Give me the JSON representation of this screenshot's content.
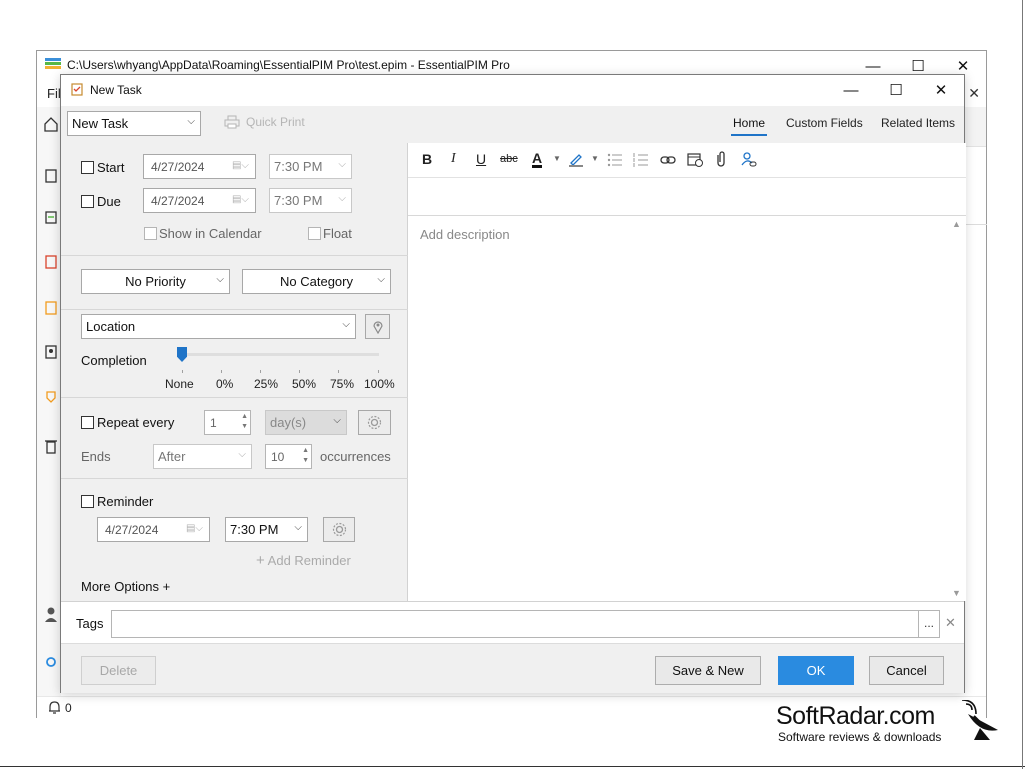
{
  "main_window": {
    "title": "C:\\Users\\whyang\\AppData\\Roaming\\EssentialPIM Pro\\test.epim - EssentialPIM Pro",
    "menu_partial": "Fil",
    "status_count": "0"
  },
  "dialog": {
    "title": "New Task",
    "type_select": "New Task",
    "quick_print": "Quick Print",
    "tabs": [
      "Home",
      "Custom Fields",
      "Related Items"
    ],
    "active_tab": "Home"
  },
  "dates": {
    "start_label": "Start",
    "start_date": "4/27/2024",
    "start_time": "7:30 PM",
    "due_label": "Due",
    "due_date": "4/27/2024",
    "due_time": "7:30 PM",
    "show_in_calendar": "Show in Calendar",
    "float": "Float"
  },
  "classify": {
    "priority": "No Priority",
    "category": "No Category"
  },
  "location": {
    "placeholder": "Location"
  },
  "completion": {
    "label": "Completion",
    "value": "None",
    "ticks": [
      "None",
      "0%",
      "25%",
      "50%",
      "75%",
      "100%"
    ]
  },
  "repeat": {
    "label": "Repeat every",
    "count": "1",
    "unit": "day(s)",
    "ends_label": "Ends",
    "ends_mode": "After",
    "occurrences": "10",
    "occurrences_label": "occurrences"
  },
  "reminder": {
    "label": "Reminder",
    "date": "4/27/2024",
    "time": "7:30 PM",
    "add_label": "Add Reminder"
  },
  "more_options": "More Options +",
  "editor": {
    "buttons": [
      "B",
      "I",
      "U",
      "abc",
      "A"
    ],
    "description_placeholder": "Add description"
  },
  "tags": {
    "label": "Tags",
    "more": "..."
  },
  "footer": {
    "delete": "Delete",
    "save_new": "Save & New",
    "ok": "OK",
    "cancel": "Cancel"
  },
  "colors": {
    "accent": "#2a8be0",
    "tab_underline": "#1f74c8",
    "slider": "#1f74c8"
  },
  "watermark": {
    "name": "SoftRadar.com",
    "tagline": "Software reviews & downloads"
  }
}
